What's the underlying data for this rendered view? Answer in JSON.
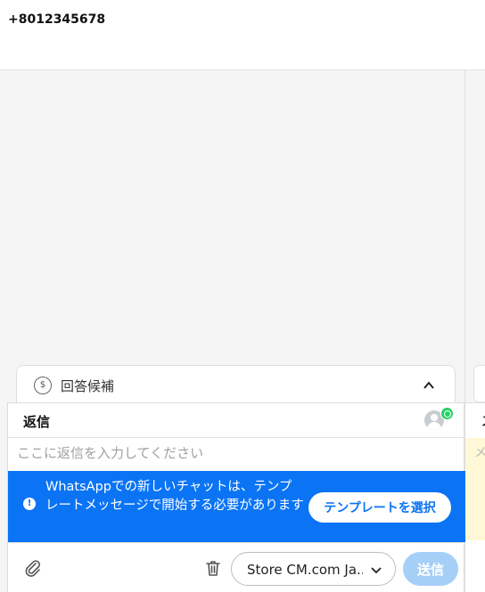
{
  "header": {
    "phone": "+8012345678"
  },
  "suggestions": {
    "label": "回答候補",
    "icon": "dollar-bubble-icon"
  },
  "reply": {
    "title": "返信",
    "placeholder": "ここに返信を入力してください",
    "channel_icon": "whatsapp-icon"
  },
  "banner": {
    "message": "WhatsAppでの新しいチャットは、テンプレートメッセージで開始する必要があります",
    "button": "テンプレートを選択",
    "color": "#0a74f5"
  },
  "composer": {
    "store_select_value": "Store CM.com Ja...",
    "send_label": "送信",
    "send_color": "#a6cff7"
  },
  "right_panel": {
    "reply_fragment": "ス",
    "input_fragment": "メ"
  }
}
